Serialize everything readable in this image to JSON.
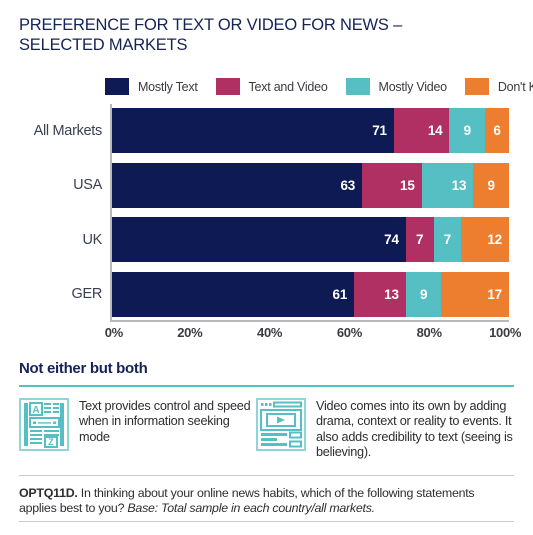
{
  "title": "PREFERENCE FOR TEXT OR VIDEO FOR NEWS – SELECTED MARKETS",
  "legend": [
    {
      "label": "Mostly Text",
      "color": "#0d1a54"
    },
    {
      "label": "Text and Video",
      "color": "#b03063"
    },
    {
      "label": "Mostly Video",
      "color": "#55bfc4"
    },
    {
      "label": "Don't Know",
      "color": "#ed7d2f"
    }
  ],
  "xticks": [
    "0%",
    "20%",
    "40%",
    "60%",
    "80%",
    "100%"
  ],
  "chart_data": {
    "type": "bar",
    "orientation": "horizontal",
    "stacked": true,
    "title": "PREFERENCE FOR TEXT OR VIDEO FOR NEWS – SELECTED MARKETS",
    "xlabel": "",
    "ylabel": "",
    "xlim": [
      0,
      100
    ],
    "grid": false,
    "legend_position": "top",
    "categories": [
      "All Markets",
      "USA",
      "UK",
      "GER"
    ],
    "series": [
      {
        "name": "Mostly Text",
        "color": "#0d1a54",
        "values": [
          71,
          63,
          74,
          61
        ]
      },
      {
        "name": "Text and Video",
        "color": "#b03063",
        "values": [
          14,
          15,
          7,
          13
        ]
      },
      {
        "name": "Mostly Video",
        "color": "#55bfc4",
        "values": [
          9,
          13,
          7,
          9
        ]
      },
      {
        "name": "Don't Know",
        "color": "#ed7d2f",
        "values": [
          6,
          9,
          12,
          17
        ]
      }
    ]
  },
  "section": {
    "heading": "Not either but both",
    "blocks": [
      {
        "icon": "article-text-icon",
        "text": "Text provides control and speed when in information seeking mode"
      },
      {
        "icon": "video-player-icon",
        "text": "Video comes into its own by adding drama, context or reality to events. It also adds credibility to text (seeing is believing)."
      }
    ]
  },
  "footnote": {
    "code": "OPTQ11D.",
    "question": " In thinking about your online news habits, which of the following statements applies best to you? ",
    "base": "Base: Total sample in each country/all markets."
  }
}
